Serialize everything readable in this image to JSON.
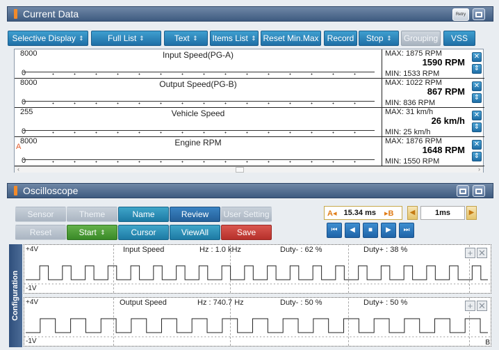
{
  "current_data": {
    "title": "Current Data",
    "retry_label": "Retry",
    "toolbar": [
      {
        "label": "Selective Display",
        "caret": true,
        "style": "blue"
      },
      {
        "label": "Full List",
        "caret": true,
        "style": "blue"
      },
      {
        "label": "Text",
        "caret": true,
        "style": "blue"
      },
      {
        "label": "Items List",
        "caret": true,
        "style": "blue"
      },
      {
        "label": "Reset Min.Max",
        "caret": false,
        "style": "blue"
      },
      {
        "label": "Record",
        "caret": false,
        "style": "blue"
      },
      {
        "label": "Stop",
        "caret": true,
        "style": "blue"
      },
      {
        "label": "Grouping",
        "caret": false,
        "style": "gray"
      },
      {
        "label": "VSS",
        "caret": false,
        "style": "blue"
      }
    ],
    "channels": [
      {
        "name": "Input Speed(PG-A)",
        "scale_max": "8000",
        "scale_min": "0",
        "max": "MAX:  1875 RPM",
        "current": "1590 RPM",
        "min": "MIN:  1533 RPM"
      },
      {
        "name": "Output Speed(PG-B)",
        "scale_max": "8000",
        "scale_min": "0",
        "max": "MAX:  1022 RPM",
        "current": "867 RPM",
        "min": "MIN:  836 RPM"
      },
      {
        "name": "Vehicle Speed",
        "scale_max": "255",
        "scale_min": "0",
        "max": "MAX:      31 km/h",
        "current": "26 km/h",
        "min": "MIN:     25 km/h"
      },
      {
        "name": "Engine RPM",
        "scale_max": "8000",
        "scale_min": "0",
        "max": "MAX:  1876 RPM",
        "current": "1648 RPM",
        "min": "MIN:  1550 RPM"
      }
    ],
    "cursor_marker": "A"
  },
  "oscilloscope": {
    "title": "Oscilloscope",
    "buttons_row1": [
      {
        "label": "Sensor",
        "style": "dis"
      },
      {
        "label": "Theme",
        "style": "dis"
      },
      {
        "label": "Name",
        "style": "teal"
      },
      {
        "label": "Review",
        "style": "blue"
      },
      {
        "label": "User Setting",
        "style": "dis"
      }
    ],
    "buttons_row2": [
      {
        "label": "Reset",
        "style": "dis"
      },
      {
        "label": "Start",
        "style": "green",
        "caret": true
      },
      {
        "label": "Cursor",
        "style": "teal"
      },
      {
        "label": "ViewAll",
        "style": "teal"
      },
      {
        "label": "Save",
        "style": "red"
      }
    ],
    "cursor_a": "A",
    "cursor_b": "B",
    "time_value": "15.34 ms",
    "time_scale": "1ms",
    "config_label": "Configuration",
    "channels": [
      {
        "v_top": "+4V",
        "v_bottom": "-1V",
        "name": "Input Speed",
        "hz": "Hz : 1.0 kHz",
        "duty_minus": "Duty- : 62 %",
        "duty_plus": "Duty+ : 38 %",
        "pulse_count": 20
      },
      {
        "v_top": "+4V",
        "v_bottom": "-1V",
        "name": "Output Speed",
        "hz": "Hz : 740.7 Hz",
        "duty_minus": "Duty- : 50 %",
        "duty_plus": "Duty+ : 50 %",
        "pulse_count": 15
      }
    ],
    "bottom_marker": "B"
  }
}
